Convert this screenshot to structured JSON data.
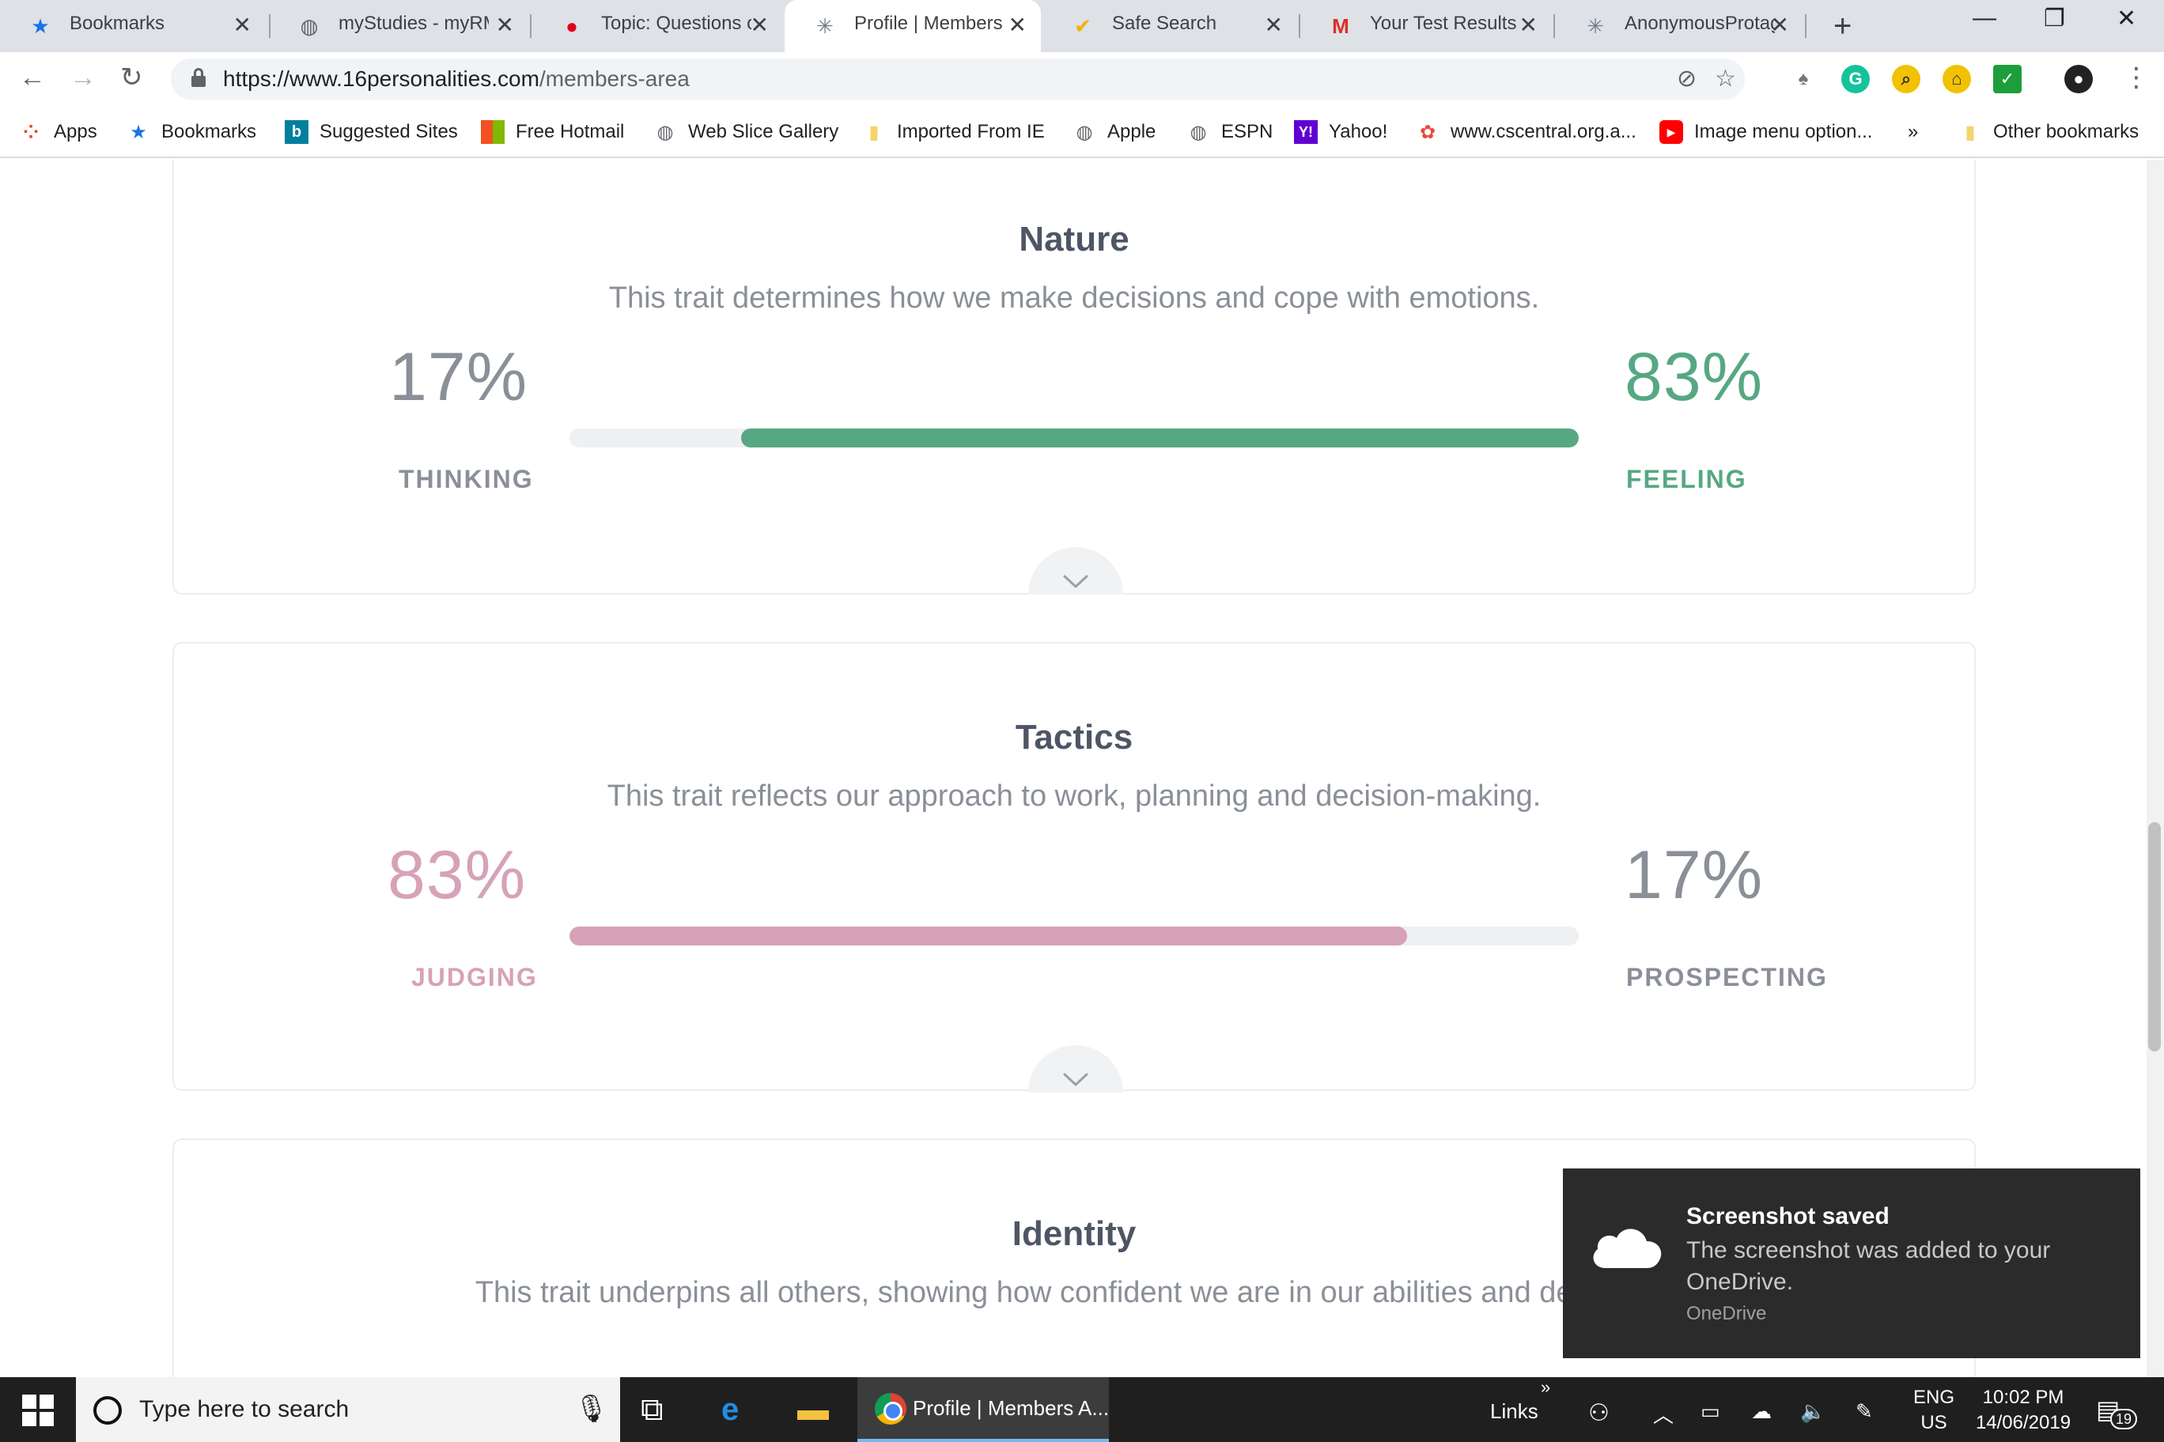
{
  "browser": {
    "tabs": [
      {
        "title": "Bookmarks",
        "icon": "star-icon"
      },
      {
        "title": "myStudies - myRM",
        "icon": "globe-icon"
      },
      {
        "title": "Topic: Questions o",
        "icon": "red-circle-icon"
      },
      {
        "title": "Profile | Members",
        "icon": "16personalities-icon",
        "active": true
      },
      {
        "title": "Safe Search",
        "icon": "check-badge-icon"
      },
      {
        "title": "Your Test Results -",
        "icon": "gmail-icon"
      },
      {
        "title": "AnonymousProtag",
        "icon": "16personalities-icon"
      }
    ],
    "url_host": "https://www.16personalities.com",
    "url_path": "/members-area",
    "bookmarks": [
      {
        "label": "Apps",
        "icon": "apps-grid-icon"
      },
      {
        "label": "Bookmarks",
        "icon": "star-icon"
      },
      {
        "label": "Suggested Sites",
        "icon": "bing-icon"
      },
      {
        "label": "Free Hotmail",
        "icon": "windows-logo-icon"
      },
      {
        "label": "Web Slice Gallery",
        "icon": "globe-icon"
      },
      {
        "label": "Imported From IE",
        "icon": "folder-icon"
      },
      {
        "label": "Apple",
        "icon": "globe-icon"
      },
      {
        "label": "ESPN",
        "icon": "globe-icon"
      },
      {
        "label": "Yahoo!",
        "icon": "yahoo-icon"
      },
      {
        "label": "www.cscentral.org.a...",
        "icon": "colorful-icon"
      },
      {
        "label": "Image menu option...",
        "icon": "youtube-icon"
      },
      {
        "label": "»",
        "icon": "overflow-chevron-icon"
      },
      {
        "label": "Other bookmarks",
        "icon": "folder-icon"
      }
    ]
  },
  "traits": [
    {
      "title": "Nature",
      "description": "This trait determines how we make decisions and cope with emotions.",
      "left": {
        "percent": "17%",
        "label": "THINKING"
      },
      "right": {
        "percent": "83%",
        "label": "FEELING"
      },
      "dominant": "right",
      "dominant_fraction": 0.83,
      "color": "#56a882"
    },
    {
      "title": "Tactics",
      "description": "This trait reflects our approach to work, planning and decision-making.",
      "left": {
        "percent": "83%",
        "label": "JUDGING"
      },
      "right": {
        "percent": "17%",
        "label": "PROSPECTING"
      },
      "dominant": "left",
      "dominant_fraction": 0.83,
      "color": "#d6a2b8"
    },
    {
      "title": "Identity",
      "description": "This trait underpins all others, showing how confident we are in our abilities and decisions."
    }
  ],
  "neutral_color": "#8a8f98",
  "toast": {
    "title": "Screenshot saved",
    "message": "The screenshot was added to your OneDrive.",
    "source": "OneDrive"
  },
  "taskbar": {
    "search_placeholder": "Type here to search",
    "active_app": "Profile | Members A...",
    "links_label": "Links",
    "lang_top": "ENG",
    "lang_bottom": "US",
    "time": "10:02 PM",
    "date": "14/06/2019",
    "notification_count": "19"
  }
}
